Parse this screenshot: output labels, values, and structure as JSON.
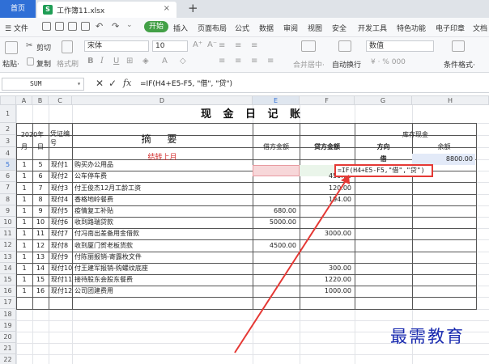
{
  "tabs": {
    "home": "首页",
    "file": "工作簿11.xlsx",
    "close": "×",
    "add": "+"
  },
  "menu": {
    "hamburger": "☰ 文件",
    "items": [
      "开始",
      "插入",
      "页面布局",
      "公式",
      "数据",
      "审阅",
      "视图",
      "安全",
      "开发工具",
      "特色功能",
      "电子印章",
      "文档"
    ]
  },
  "ribbon": {
    "paste": "粘贴·",
    "cut": "剪切",
    "copy": "复制",
    "format_painter": "格式刷",
    "font_name": "宋体",
    "font_size": "10",
    "bold": "B",
    "italic": "I",
    "underline": "U",
    "font_grow": "A⁺",
    "font_shrink": "A⁻",
    "merge": "合并居中·",
    "wrap": "自动换行",
    "number_format": "数值",
    "currency": "¥ · % 000",
    "cond_format": "条件格式·"
  },
  "formula_bar": {
    "name_box": "SUM",
    "cancel": "✕",
    "confirm": "✓",
    "fx": "fx",
    "content": "=IF(H4+E5-F5, \"借\", \"贷\")"
  },
  "columns": [
    "A",
    "B",
    "C",
    "D",
    "E",
    "F",
    "G",
    "H"
  ],
  "row_numbers": [
    "1",
    "2",
    "3",
    "4",
    "5",
    "6",
    "7",
    "8",
    "9",
    "10",
    "11",
    "12",
    "13",
    "14",
    "15",
    "16",
    "17",
    "18",
    "19",
    "20",
    "21",
    "22",
    "23"
  ],
  "sheet": {
    "title": "现 金 日 记 账",
    "year": "2020年",
    "month": "月",
    "day": "日",
    "voucher": "凭证编号",
    "summary": "摘    要",
    "debit": "借方金额",
    "credit": "贷方金额",
    "inventory_group": "库存现金",
    "direction": "方向",
    "balance": "余额",
    "carry_forward": "结转上月",
    "carry_direction": "借",
    "carry_balance": "8800.00",
    "formula_popup": "=IF(H4+E5-F5,\"借\",\"贷\")",
    "rows": [
      {
        "m": "1",
        "d": "5",
        "v": "现付1",
        "s": "购买办公用品",
        "e": "",
        "f": ""
      },
      {
        "m": "1",
        "d": "6",
        "v": "现付2",
        "s": "公车停车费",
        "e": "",
        "f": "450.00"
      },
      {
        "m": "1",
        "d": "7",
        "v": "现付3",
        "s": "付王俊杰12月工龄工资",
        "e": "",
        "f": "120.00"
      },
      {
        "m": "1",
        "d": "8",
        "v": "现付4",
        "s": "香格地岭餐费",
        "e": "",
        "f": "194.00"
      },
      {
        "m": "1",
        "d": "9",
        "v": "现付5",
        "s": "疫情复工补贴",
        "e": "680.00",
        "f": ""
      },
      {
        "m": "1",
        "d": "10",
        "v": "现付6",
        "s": "收到路瑞贷款",
        "e": "5000.00",
        "f": ""
      },
      {
        "m": "1",
        "d": "11",
        "v": "现付7",
        "s": "付冯南出差备用金借款",
        "e": "",
        "f": "3000.00"
      },
      {
        "m": "1",
        "d": "12",
        "v": "现付8",
        "s": "收到厦门贺老板货款",
        "e": "4500.00",
        "f": ""
      },
      {
        "m": "1",
        "d": "13",
        "v": "现付9",
        "s": "付陈丽报销-寄露枚文件",
        "e": "",
        "f": ""
      },
      {
        "m": "1",
        "d": "14",
        "v": "现付10",
        "s": "付王建军报销-购螺纹底座",
        "e": "",
        "f": "300.00"
      },
      {
        "m": "1",
        "d": "15",
        "v": "现付11",
        "s": "接待股东会股东餐费",
        "e": "",
        "f": "1220.00"
      },
      {
        "m": "1",
        "d": "16",
        "v": "现付12",
        "s": "公司团建费用",
        "e": "",
        "f": "1000.00"
      }
    ]
  },
  "watermark": "最需教育"
}
